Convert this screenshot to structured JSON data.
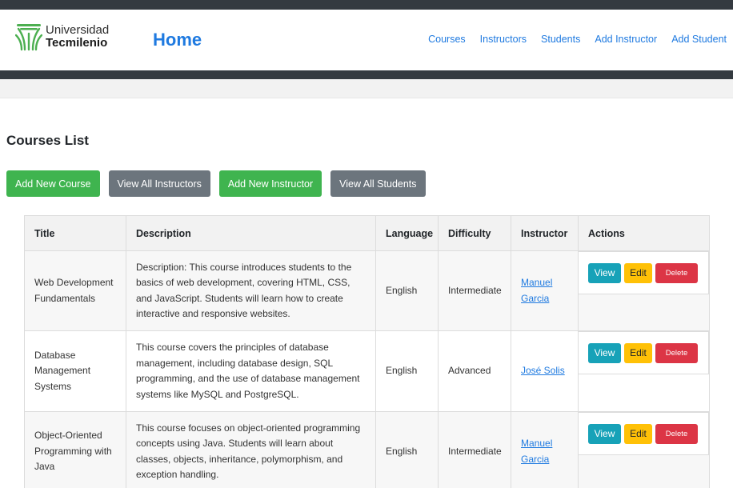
{
  "brand": {
    "line1": "Universidad",
    "line2": "Tecmilenio",
    "mark": "ut-logo-mark",
    "color": "#4caf50"
  },
  "header": {
    "title": "Home",
    "nav": [
      "Courses",
      "Instructors",
      "Students",
      "Add Instructor",
      "Add Student"
    ]
  },
  "main": {
    "section_title": "Courses List",
    "buttons": [
      "Add New Course",
      "View All Instructors",
      "Add New Instructor",
      "View All Students"
    ]
  },
  "table": {
    "columns": [
      "Title",
      "Description",
      "Language",
      "Difficulty",
      "Instructor",
      "Actions"
    ],
    "rows": [
      {
        "title": "Web Development Fundamentals",
        "description": "Description: This course introduces students to the basics of web development, covering HTML, CSS, and JavaScript. Students will learn how to create interactive and responsive websites.",
        "language": "English",
        "difficulty": "Intermediate",
        "instructor": "Manuel Garcia"
      },
      {
        "title": "Database Management Systems",
        "description": "This course covers the principles of database management, including database design, SQL programming, and the use of database management systems like MySQL and PostgreSQL.",
        "language": "English",
        "difficulty": "Advanced",
        "instructor": "José Solis"
      },
      {
        "title": "Object-Oriented Programming with Java",
        "description": "This course focuses on object-oriented programming concepts using Java. Students will learn about classes, objects, inheritance, polymorphism, and exception handling.",
        "language": "English",
        "difficulty": "Intermediate",
        "instructor": "Manuel Garcia"
      }
    ],
    "actions": {
      "view": "View",
      "edit": "Edit",
      "delete": "Delete"
    }
  },
  "colors": {
    "dark_bar": "#343a40",
    "link": "#1f7ae0",
    "success": "#3fb44f",
    "secondary": "#6c757d",
    "info": "#17a2b8",
    "warning": "#ffc107",
    "danger": "#dc3545"
  }
}
